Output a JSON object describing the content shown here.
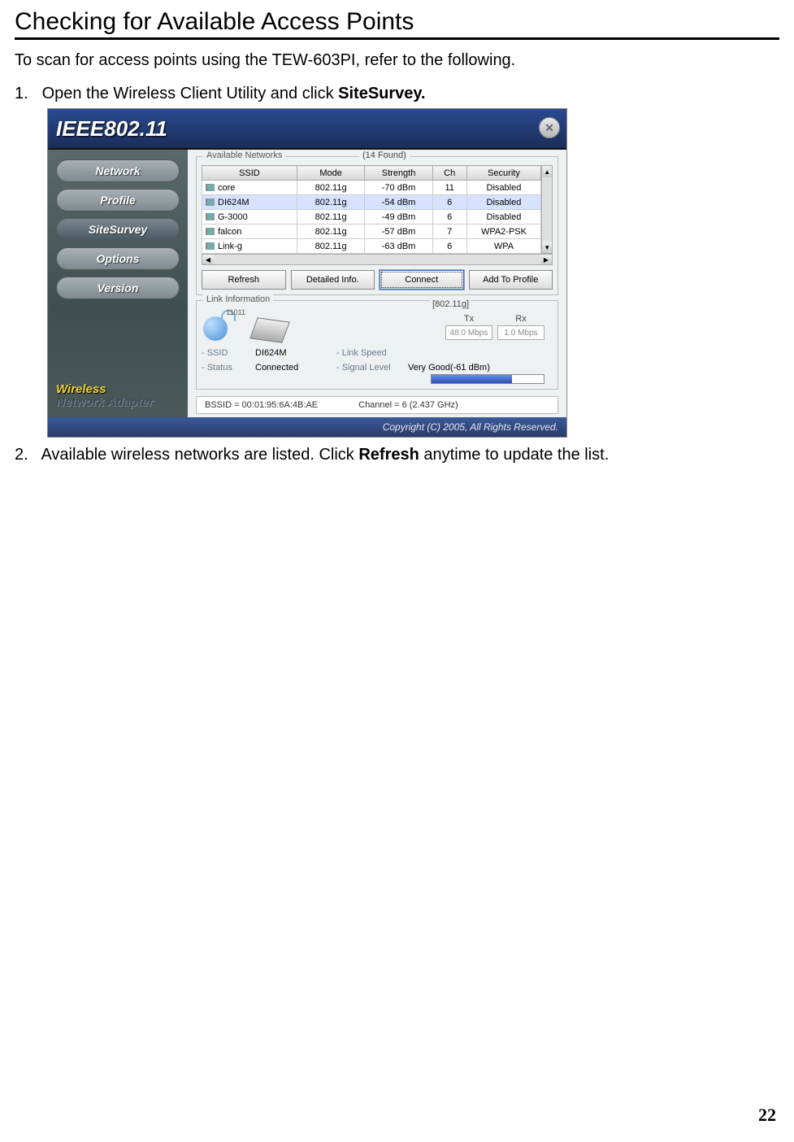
{
  "doc": {
    "heading": "Checking for Available Access Points",
    "intro": "To scan for access points using the TEW-603PI, refer to the following.",
    "step1_num": "1.",
    "step1_a": "Open the Wireless Client Utility and click ",
    "step1_b": "SiteSurvey.",
    "step2_num": "2.",
    "step2_a": "Available wireless networks are listed. Click ",
    "step2_b": "Refresh",
    "step2_c": " anytime to update the list.",
    "page": "22"
  },
  "app": {
    "title": "IEEE802.11",
    "close": "✕",
    "nav": {
      "network": "Network",
      "profile": "Profile",
      "sitesurvey": "SiteSurvey",
      "options": "Options",
      "version": "Version"
    },
    "sidebar_footer1": "Wireless",
    "sidebar_footer2": "Network Adapter",
    "available_label": "Available Networks",
    "found": "(14 Found)",
    "cols": {
      "ssid": "SSID",
      "mode": "Mode",
      "strength": "Strength",
      "ch": "Ch",
      "security": "Security"
    },
    "rows": [
      {
        "ssid": "core",
        "mode": "802.11g",
        "str": "-70 dBm",
        "ch": "11",
        "sec": "Disabled",
        "sel": false
      },
      {
        "ssid": "DI624M",
        "mode": "802.11g",
        "str": "-54 dBm",
        "ch": "6",
        "sec": "Disabled",
        "sel": true
      },
      {
        "ssid": "G-3000",
        "mode": "802.11g",
        "str": "-49 dBm",
        "ch": "6",
        "sec": "Disabled",
        "sel": false
      },
      {
        "ssid": "falcon",
        "mode": "802.11g",
        "str": "-57 dBm",
        "ch": "7",
        "sec": "WPA2-PSK",
        "sel": false
      },
      {
        "ssid": "Link-g",
        "mode": "802.11g",
        "str": "-63 dBm",
        "ch": "6",
        "sec": "WPA",
        "sel": false
      }
    ],
    "buttons": {
      "refresh": "Refresh",
      "detail": "Detailed Info.",
      "connect": "Connect",
      "add": "Add To Profile"
    },
    "link_group": "Link Information",
    "wifi_num": "11011",
    "mode_tag": "[802.11g]",
    "tx_lbl": "Tx",
    "rx_lbl": "Rx",
    "tx_val": "48.0 Mbps",
    "rx_val": "1.0 Mbps",
    "ssid_k": "- SSID",
    "ssid_v": "DI624M",
    "status_k": "- Status",
    "status_v": "Connected",
    "speed_k": "- Link Speed",
    "sig_k": "- Signal Level",
    "sig_v": "Very Good(-61 dBm)",
    "bssid": "BSSID = 00:01:95:6A:4B:AE",
    "channel": "Channel = 6 (2.437 GHz)",
    "copyright": "Copyright (C) 2005, All Rights Reserved."
  }
}
